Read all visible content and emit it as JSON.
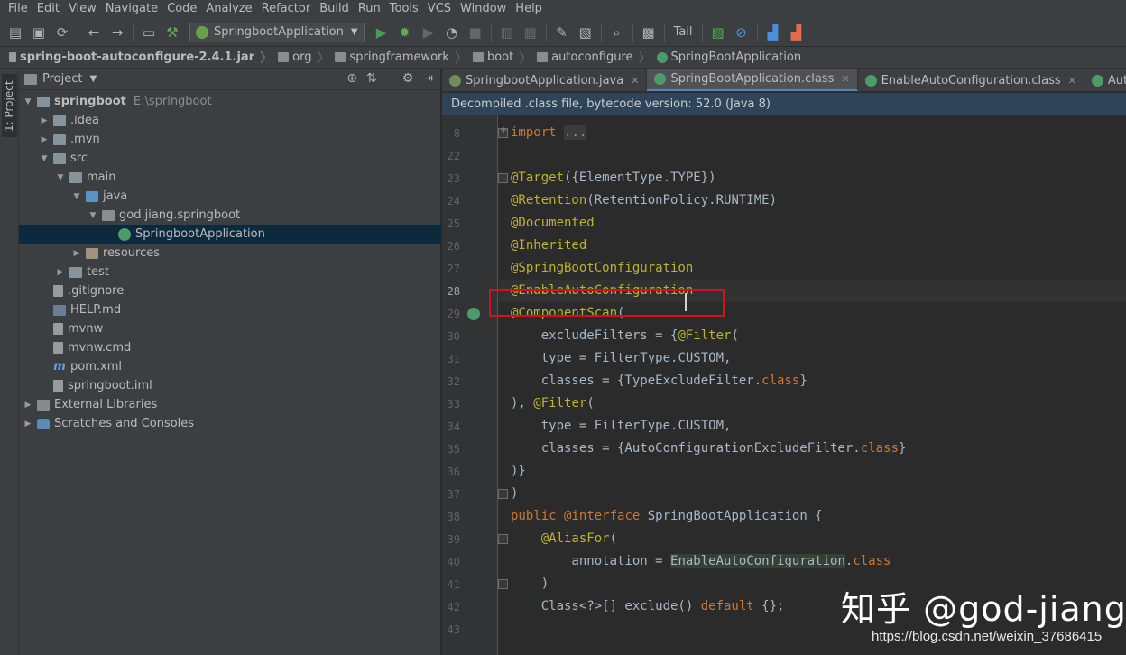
{
  "menu": [
    "File",
    "Edit",
    "View",
    "Navigate",
    "Code",
    "Analyze",
    "Refactor",
    "Build",
    "Run",
    "Tools",
    "VCS",
    "Window",
    "Help"
  ],
  "toolbar": {
    "run_config": "SpringbootApplication",
    "tail_label": "Tail",
    "icons": [
      "save-all-icon",
      "save-icon",
      "sync-icon",
      "back-icon",
      "forward-icon",
      "structure-icon",
      "build-hammer-icon",
      "run-icon",
      "debug-icon",
      "coverage-icon",
      "profile-icon",
      "stop-icon",
      "ant-icon",
      "settings-wrench-icon",
      "project-structure-icon",
      "search-icon",
      "terminal-icon",
      "chart-icon",
      "no-icon",
      "translate-icon",
      "translate-alt-icon"
    ]
  },
  "breadcrumbs": [
    "spring-boot-autoconfigure-2.4.1.jar",
    "org",
    "springframework",
    "boot",
    "autoconfigure",
    "SpringBootApplication"
  ],
  "sidebar": {
    "tab_label": "1: Project"
  },
  "project_panel": {
    "title": "Project",
    "tree": [
      {
        "label": "springboot",
        "path": "E:\\springboot",
        "depth": 0,
        "toggle": "▼",
        "icon": "folder"
      },
      {
        "label": ".idea",
        "depth": 1,
        "toggle": "▶",
        "icon": "folder"
      },
      {
        "label": ".mvn",
        "depth": 1,
        "toggle": "▶",
        "icon": "folder"
      },
      {
        "label": "src",
        "depth": 1,
        "toggle": "▼",
        "icon": "folder"
      },
      {
        "label": "main",
        "depth": 2,
        "toggle": "▼",
        "icon": "folder"
      },
      {
        "label": "java",
        "depth": 3,
        "toggle": "▼",
        "icon": "folder-blue"
      },
      {
        "label": "god.jiang.springboot",
        "depth": 4,
        "toggle": "▼",
        "icon": "pkg"
      },
      {
        "label": "SpringbootApplication",
        "depth": 5,
        "toggle": "",
        "icon": "spring",
        "selected": true
      },
      {
        "label": "resources",
        "depth": 3,
        "toggle": "▶",
        "icon": "folder-res"
      },
      {
        "label": "test",
        "depth": 2,
        "toggle": "▶",
        "icon": "folder"
      },
      {
        "label": ".gitignore",
        "depth": 1,
        "toggle": "",
        "icon": "file"
      },
      {
        "label": "HELP.md",
        "depth": 1,
        "toggle": "",
        "icon": "md"
      },
      {
        "label": "mvnw",
        "depth": 1,
        "toggle": "",
        "icon": "file"
      },
      {
        "label": "mvnw.cmd",
        "depth": 1,
        "toggle": "",
        "icon": "file"
      },
      {
        "label": "pom.xml",
        "depth": 1,
        "toggle": "",
        "icon": "maven"
      },
      {
        "label": "springboot.iml",
        "depth": 1,
        "toggle": "",
        "icon": "file"
      },
      {
        "label": "External Libraries",
        "depth": 0,
        "toggle": "▶",
        "icon": "lib"
      },
      {
        "label": "Scratches and Consoles",
        "depth": 0,
        "toggle": "▶",
        "icon": "scratch"
      }
    ]
  },
  "editor": {
    "tabs": [
      {
        "label": "SpringbootApplication.java",
        "active": false
      },
      {
        "label": "SpringBootApplication.class",
        "active": true
      },
      {
        "label": "EnableAutoConfiguration.class",
        "active": false
      },
      {
        "label": "AutoConfigurat",
        "active": false
      }
    ],
    "notice": "Decompiled .class file, bytecode version: 52.0 (Java 8)",
    "current_line": "28",
    "lines": [
      {
        "n": "7",
        "tokens": []
      },
      {
        "n": "8",
        "tokens": [
          {
            "t": "import",
            "c": "kw"
          },
          {
            "t": " "
          },
          {
            "t": "...",
            "c": "fold-txt"
          }
        ]
      },
      {
        "n": "22",
        "tokens": []
      },
      {
        "n": "23",
        "tokens": [
          {
            "t": "@Target",
            "c": "ann"
          },
          {
            "t": "({ElementType.TYPE})"
          }
        ]
      },
      {
        "n": "24",
        "tokens": [
          {
            "t": "@Retention",
            "c": "ann"
          },
          {
            "t": "(RetentionPolicy.RUNTIME)"
          }
        ]
      },
      {
        "n": "25",
        "tokens": [
          {
            "t": "@Documented",
            "c": "ann"
          }
        ]
      },
      {
        "n": "26",
        "tokens": [
          {
            "t": "@Inherited",
            "c": "ann"
          }
        ]
      },
      {
        "n": "27",
        "tokens": [
          {
            "t": "@SpringBootConfiguration",
            "c": "ann"
          }
        ]
      },
      {
        "n": "28",
        "tokens": [
          {
            "t": "@EnableAutoConfiguration",
            "c": "ann"
          }
        ]
      },
      {
        "n": "29",
        "tokens": [
          {
            "t": "@ComponentScan",
            "c": "ann"
          },
          {
            "t": "("
          }
        ]
      },
      {
        "n": "30",
        "tokens": [
          {
            "t": "    excludeFilters = {"
          },
          {
            "t": "@Filter",
            "c": "ann"
          },
          {
            "t": "("
          }
        ]
      },
      {
        "n": "31",
        "tokens": [
          {
            "t": "    type = FilterType."
          },
          {
            "t": "CUSTOM",
            "c": "kw2"
          },
          {
            "t": ","
          }
        ]
      },
      {
        "n": "32",
        "tokens": [
          {
            "t": "    classes = {TypeExcludeFilter."
          },
          {
            "t": "class",
            "c": "kw"
          },
          {
            "t": "}"
          }
        ]
      },
      {
        "n": "33",
        "tokens": [
          {
            "t": "), "
          },
          {
            "t": "@Filter",
            "c": "ann"
          },
          {
            "t": "("
          }
        ]
      },
      {
        "n": "34",
        "tokens": [
          {
            "t": "    type = FilterType."
          },
          {
            "t": "CUSTOM",
            "c": "kw2"
          },
          {
            "t": ","
          }
        ]
      },
      {
        "n": "35",
        "tokens": [
          {
            "t": "    classes = {AutoConfigurationExcludeFilter."
          },
          {
            "t": "class",
            "c": "kw"
          },
          {
            "t": "}"
          }
        ]
      },
      {
        "n": "36",
        "tokens": [
          {
            "t": ")}"
          }
        ]
      },
      {
        "n": "37",
        "tokens": [
          {
            "t": ")"
          }
        ]
      },
      {
        "n": "38",
        "tokens": [
          {
            "t": "public ",
            "c": "kw"
          },
          {
            "t": "@interface",
            "c": "kw"
          },
          {
            "t": " SpringBootApplication {"
          }
        ]
      },
      {
        "n": "39",
        "tokens": [
          {
            "t": "    "
          },
          {
            "t": "@AliasFor",
            "c": "ann"
          },
          {
            "t": "("
          }
        ]
      },
      {
        "n": "40",
        "tokens": [
          {
            "t": "        annotation = "
          },
          {
            "t": "EnableAutoConfiguration",
            "c": "hl-under"
          },
          {
            "t": "."
          },
          {
            "t": "class",
            "c": "kw"
          }
        ]
      },
      {
        "n": "41",
        "tokens": [
          {
            "t": "    )"
          }
        ]
      },
      {
        "n": "42",
        "tokens": [
          {
            "t": "    Class<?>[] exclude() "
          },
          {
            "t": "default",
            "c": "kw"
          },
          {
            "t": " {};"
          }
        ]
      },
      {
        "n": "43",
        "tokens": []
      }
    ]
  },
  "watermark": {
    "zhihu": "知乎 @god-jiang",
    "csdn": "https://blog.csdn.net/weixin_37686415"
  },
  "colors": {
    "annotation": "#bbb529",
    "keyword": "#cc7832",
    "highlight_box": "#d0121b",
    "selection": "#0d293e"
  }
}
